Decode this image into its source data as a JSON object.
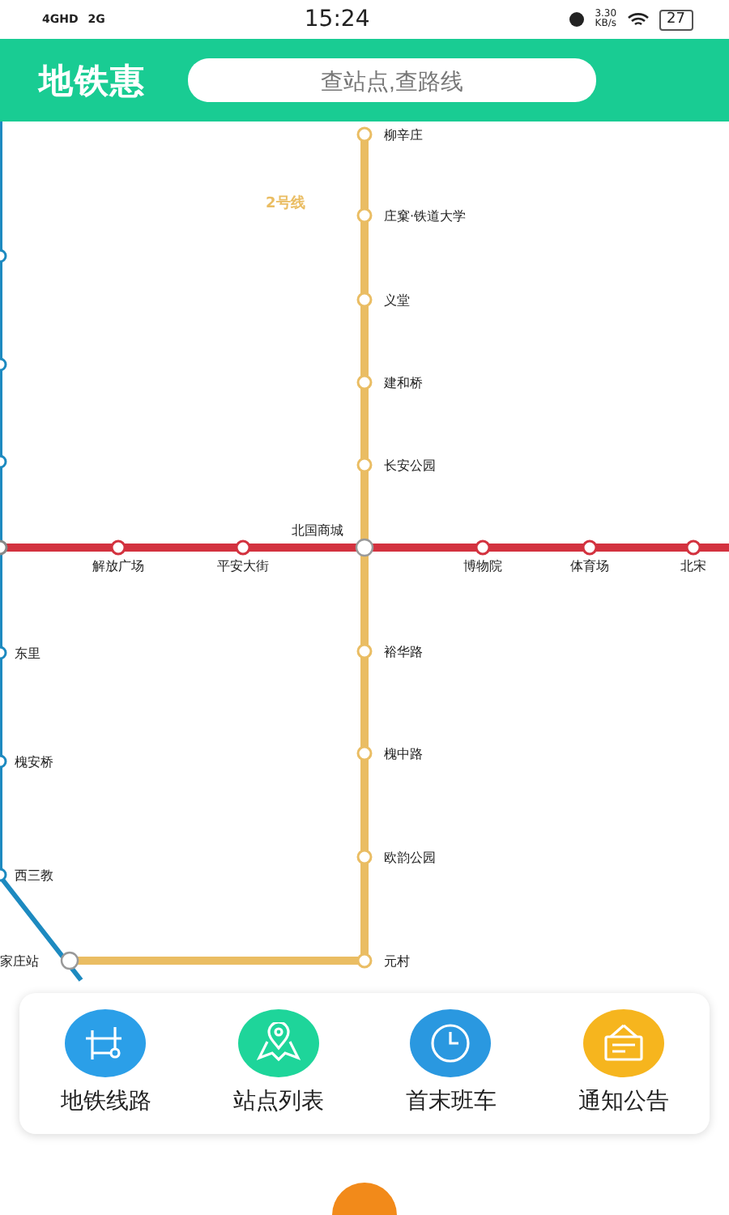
{
  "status_bar": {
    "networks": [
      "4GHD",
      "2G"
    ],
    "time": "15:24",
    "speed": "3.30",
    "speed_unit": "KB/s",
    "battery": "27"
  },
  "header": {
    "title": "地铁惠",
    "search": {
      "placeholder": "查站点,查路线"
    }
  },
  "map": {
    "line_label": "2号线",
    "yellow_stations": [
      "柳辛庄",
      "庄窠·铁道大学",
      "义堂",
      "建和桥",
      "长安公园",
      "裕华路",
      "槐中路",
      "欧韵公园",
      "元村"
    ],
    "red_stations": [
      "解放广场",
      "平安大街",
      "北国商城",
      "博物院",
      "体育场",
      "北宋"
    ],
    "blue_stations": [
      "东里",
      "槐安桥",
      "西三教",
      "家庄站"
    ]
  },
  "menu": [
    {
      "label": "地铁线路",
      "kind": "route",
      "color": "#2b9fe8"
    },
    {
      "label": "站点列表",
      "kind": "pin",
      "color": "#1ed59a"
    },
    {
      "label": "首末班车",
      "kind": "clock",
      "color": "#2a98e0"
    },
    {
      "label": "通知公告",
      "kind": "notice",
      "color": "#f6b51e"
    }
  ]
}
